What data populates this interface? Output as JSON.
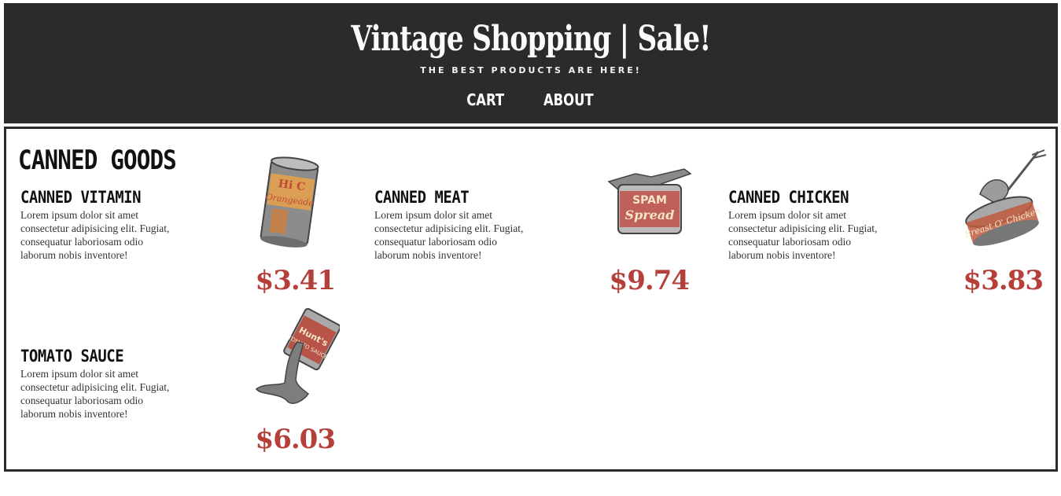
{
  "header": {
    "title": "Vintage Shopping | Sale!",
    "tagline": "THE BEST PRODUCTS ARE HERE!",
    "nav": [
      {
        "label": "CART"
      },
      {
        "label": "ABOUT"
      }
    ]
  },
  "section": {
    "title": "CANNED GOODS"
  },
  "products": [
    {
      "name": "CANNED VITAMIN",
      "description": "Lorem ipsum dolor sit amet consectetur adipisicing elit. Fugiat, consequatur laboriosam odio laborum nobis inventore!",
      "price": "$3.41",
      "image_icon": "orangeade-can-icon"
    },
    {
      "name": "CANNED MEAT",
      "description": "Lorem ipsum dolor sit amet consectetur adipisicing elit. Fugiat, consequatur laboriosam odio laborum nobis inventore!",
      "price": "$9.74",
      "image_icon": "spam-can-icon"
    },
    {
      "name": "CANNED CHICKEN",
      "description": "Lorem ipsum dolor sit amet consectetur adipisicing elit. Fugiat, consequatur laboriosam odio laborum nobis inventore!",
      "price": "$3.83",
      "image_icon": "chicken-can-icon"
    },
    {
      "name": "TOMATO SAUCE",
      "description": "Lorem ipsum dolor sit amet consectetur adipisicing elit. Fugiat, consequatur laboriosam odio laborum nobis inventore!",
      "price": "$6.03",
      "image_icon": "tomato-sauce-can-icon"
    }
  ],
  "colors": {
    "header_bg": "#2b2b2b",
    "price": "#b5403a",
    "text": "#111111"
  }
}
